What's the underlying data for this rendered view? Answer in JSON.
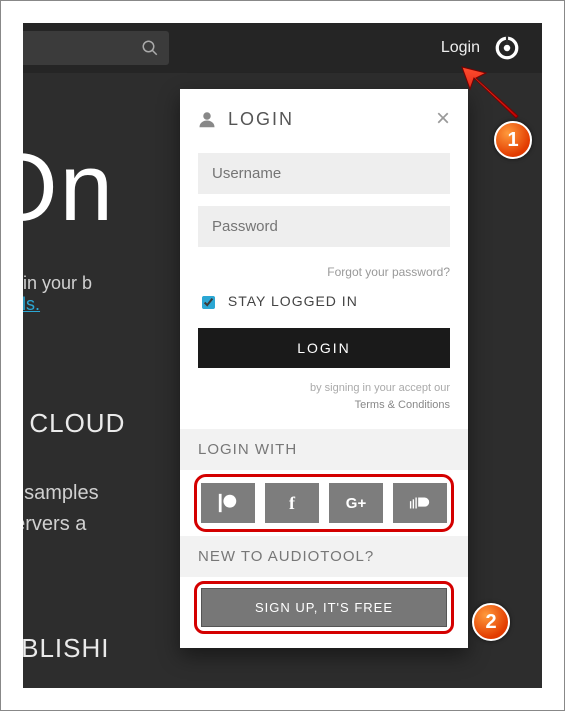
{
  "topbar": {
    "login_link": "Login"
  },
  "hero": {
    "title": "On",
    "line1_a": "right in your b",
    "line1_link": "details.",
    "heading2": "HE CLOUD",
    "line2_a": "cks, samples",
    "line2_b": "ol servers a",
    "heading3": "PUBLISHI"
  },
  "panel": {
    "title": "LOGIN",
    "username_ph": "Username",
    "password_ph": "Password",
    "forgot": "Forgot your password?",
    "stay": "STAY LOGGED IN",
    "login_btn": "LOGIN",
    "terms_pre": "by signing in your accept our",
    "terms_link": "Terms & Conditions",
    "login_with": "LOGIN WITH",
    "new_to": "NEW TO AUDIOTOOL?",
    "signup": "SIGN UP, IT'S FREE"
  },
  "callouts": {
    "one": "1",
    "two": "2"
  },
  "social": {
    "fb": "f",
    "gp": "G+"
  }
}
